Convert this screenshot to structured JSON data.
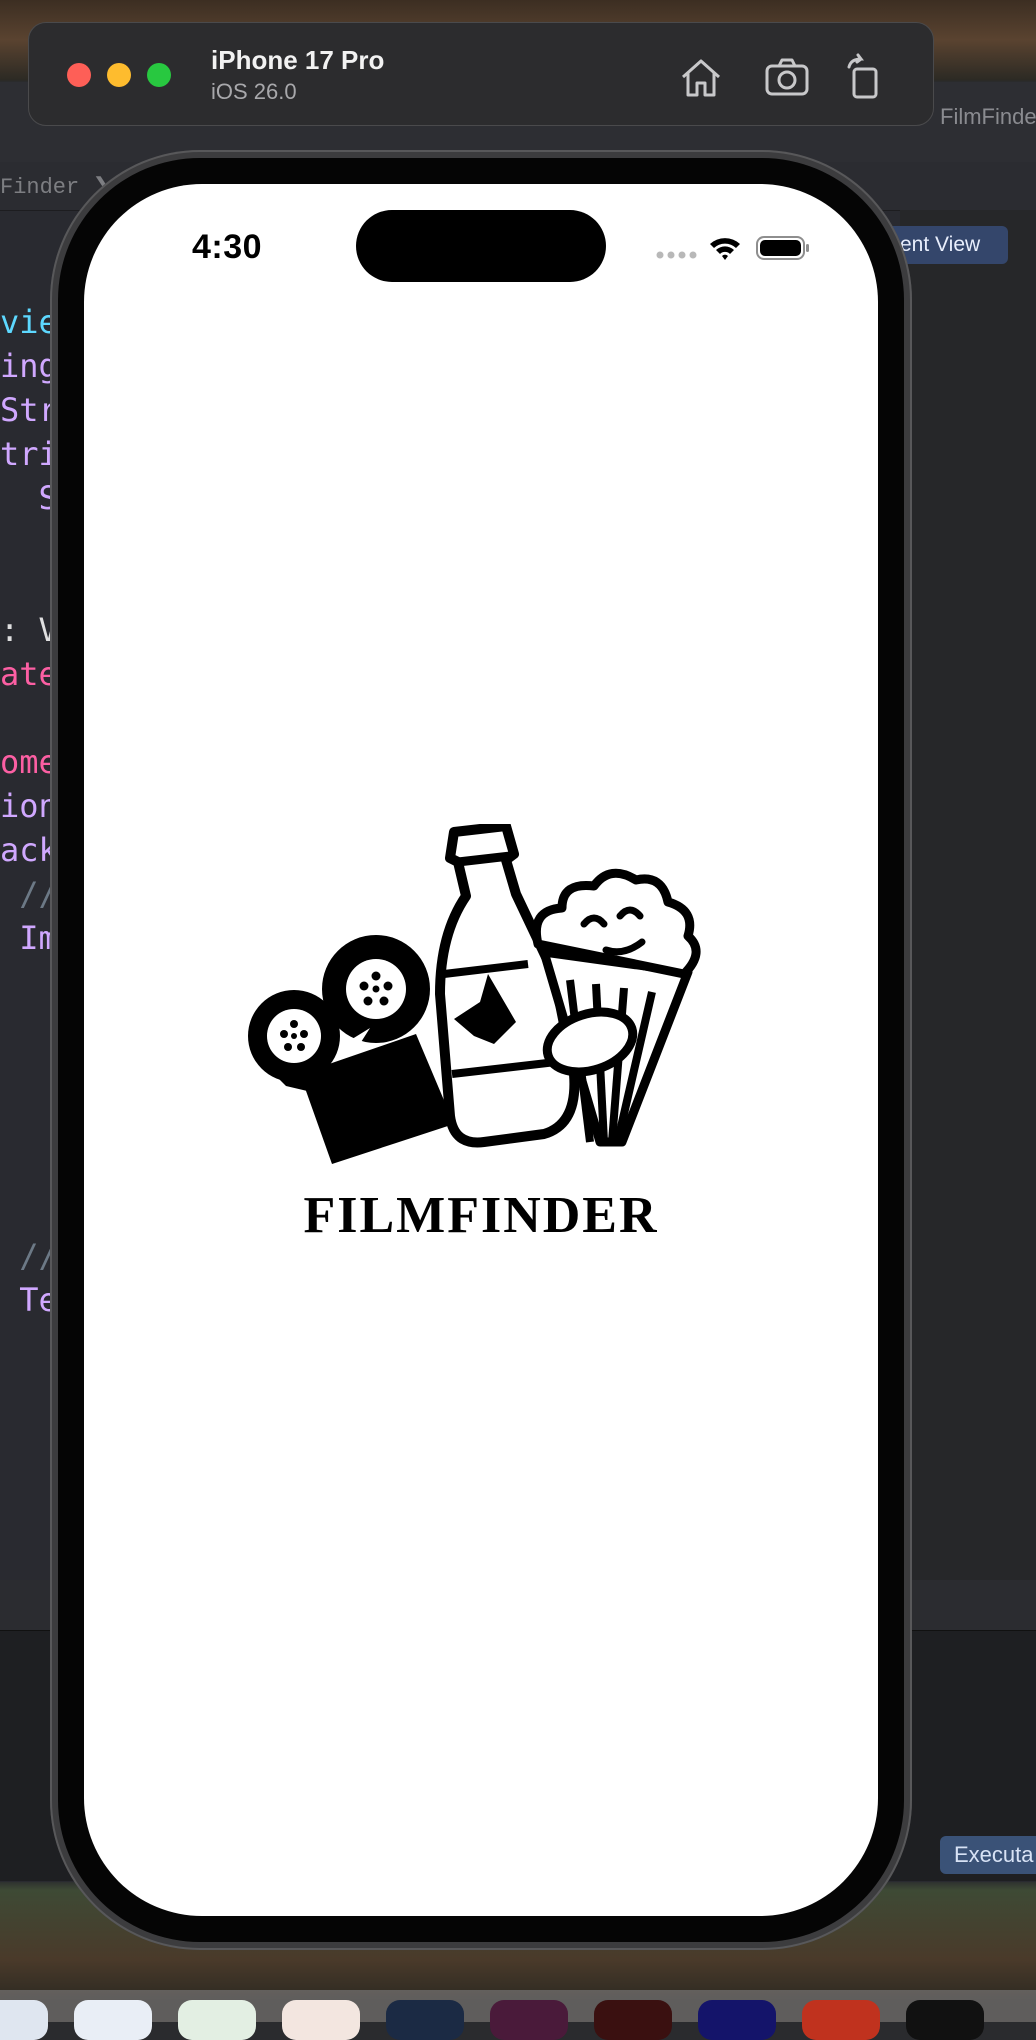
{
  "simulator": {
    "device_name": "iPhone 17 Pro",
    "os_version": "iOS 26.0",
    "tools": [
      "home-icon",
      "screenshot-icon",
      "rotate-icon"
    ]
  },
  "xcode_background": {
    "toolbar_title": "FilmFinde",
    "breadcrumb": "Finder ❯",
    "canvas_button": "ent View",
    "debug_label": "Executa",
    "code_fragments": [
      {
        "text": "vie",
        "color": "#5dd8ff"
      },
      {
        "text": "ing",
        "color": "#d0a8ff"
      },
      {
        "text": "Str",
        "color": "#d0a8ff"
      },
      {
        "text": "tri",
        "color": "#d0a8ff"
      },
      {
        "text": "  S",
        "color": "#d0a8ff"
      },
      {
        "text": "",
        "color": "#dfdfe0"
      },
      {
        "text": "",
        "color": "#dfdfe0"
      },
      {
        "text": ": V",
        "color": "#dfdfe0"
      },
      {
        "text": "ate",
        "color": "#fc5fa3"
      },
      {
        "text": "",
        "color": "#dfdfe0"
      },
      {
        "text": "ome",
        "color": "#fc5fa3"
      },
      {
        "text": "ion",
        "color": "#d0a8ff"
      },
      {
        "text": "ack",
        "color": "#d0a8ff"
      },
      {
        "text": " //",
        "color": "#6c7986"
      },
      {
        "text": " Im",
        "color": "#d0a8ff"
      }
    ],
    "code_lower": [
      {
        "text": " //",
        "color": "#6c7986"
      },
      {
        "text": " Te",
        "color": "#d0a8ff"
      }
    ]
  },
  "status_bar": {
    "time": "4:30"
  },
  "app": {
    "brand_name": "FILMFINDER",
    "logo": "film-camera-bottle-popcorn-logo"
  },
  "colors": {
    "screen_background": "#ffffff",
    "logo_color": "#000000",
    "xcode_background": "#292a30"
  }
}
